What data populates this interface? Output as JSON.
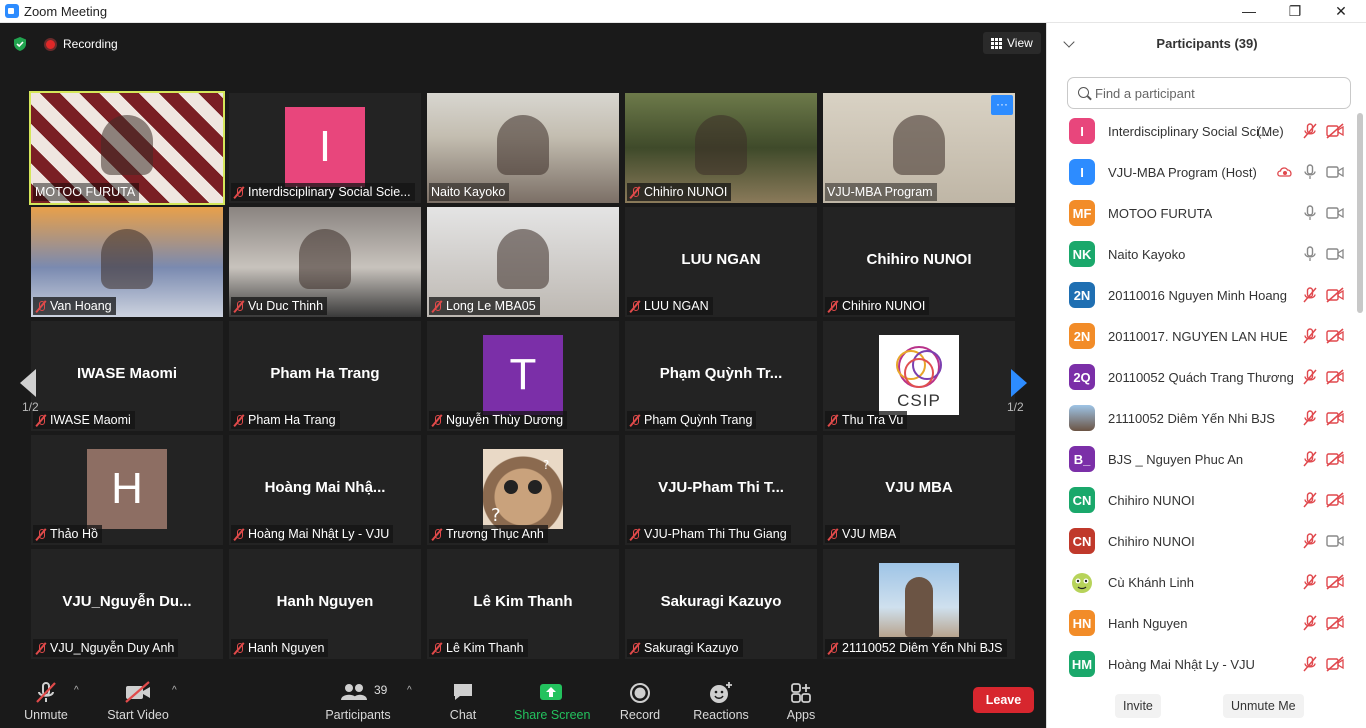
{
  "window": {
    "title": "Zoom Meeting",
    "minimize": "—",
    "restore": "❐",
    "close": "✕"
  },
  "meeting": {
    "recording_label": "Recording",
    "view_label": "View",
    "page_indicator_left": "1/2",
    "page_indicator_right": "1/2"
  },
  "tiles": [
    {
      "name": "MOTOO FURUTA",
      "muted": false,
      "kind": "video",
      "active": true
    },
    {
      "name": "Interdisciplinary Social Scie...",
      "muted": true,
      "kind": "avatar",
      "letter": "I",
      "color": "#e8467c"
    },
    {
      "name": "Naito Kayoko",
      "muted": false,
      "kind": "video"
    },
    {
      "name": "Chihiro NUNOI",
      "muted": true,
      "kind": "video"
    },
    {
      "name": "VJU-MBA Program",
      "muted": false,
      "kind": "video",
      "more": "···"
    },
    {
      "name": "Van Hoang",
      "muted": true,
      "kind": "video"
    },
    {
      "name": "Vu Duc Thinh",
      "muted": true,
      "kind": "video"
    },
    {
      "name": "Long Le MBA05",
      "muted": true,
      "kind": "video"
    },
    {
      "name": "LUU NGAN",
      "muted": true,
      "kind": "name",
      "big": "LUU NGAN"
    },
    {
      "name": "Chihiro NUNOI",
      "muted": true,
      "kind": "name",
      "big": "Chihiro NUNOI"
    },
    {
      "name": "IWASE Maomi",
      "muted": true,
      "kind": "name",
      "big": "IWASE Maomi"
    },
    {
      "name": "Pham Ha Trang",
      "muted": true,
      "kind": "name",
      "big": "Pham Ha Trang"
    },
    {
      "name": "Nguyễn Thùy Dương",
      "muted": true,
      "kind": "avatar",
      "letter": "T",
      "color": "#7b2fa8"
    },
    {
      "name": "Phạm Quỳnh Trang",
      "muted": true,
      "kind": "name",
      "big": "Phạm Quỳnh Tr..."
    },
    {
      "name": "Thu Tra Vu",
      "muted": true,
      "kind": "logo",
      "logo_text": "CSIP"
    },
    {
      "name": "Thảo Hồ",
      "muted": true,
      "kind": "avatar",
      "letter": "H",
      "color": "#8d6e63"
    },
    {
      "name": "Hoàng Mai Nhật Ly - VJU",
      "muted": true,
      "kind": "name",
      "big": "Hoàng  Mai  Nhậ..."
    },
    {
      "name": "Trương Thục Anh",
      "muted": true,
      "kind": "cat"
    },
    {
      "name": "VJU-Pham Thi Thu Giang",
      "muted": true,
      "kind": "name",
      "big": "VJU-Pham  Thi  T..."
    },
    {
      "name": "VJU MBA",
      "muted": true,
      "kind": "name",
      "big": "VJU MBA"
    },
    {
      "name": "VJU_Nguyễn Duy Anh",
      "muted": true,
      "kind": "name",
      "big": "VJU_Nguyễn  Du..."
    },
    {
      "name": "Hanh Nguyen",
      "muted": true,
      "kind": "name",
      "big": "Hanh Nguyen"
    },
    {
      "name": "Lê Kim Thanh",
      "muted": true,
      "kind": "name",
      "big": "Lê Kim Thanh"
    },
    {
      "name": "Sakuragi Kazuyo",
      "muted": true,
      "kind": "name",
      "big": "Sakuragi Kazuyo"
    },
    {
      "name": "21110052 Diêm Yến Nhi BJS",
      "muted": true,
      "kind": "portrait"
    }
  ],
  "toolbar": {
    "unmute": "Unmute",
    "start_video": "Start Video",
    "participants": "Participants",
    "participants_count": "39",
    "chat": "Chat",
    "share_screen": "Share Screen",
    "record": "Record",
    "reactions": "Reactions",
    "apps": "Apps",
    "leave": "Leave"
  },
  "panel": {
    "title": "Participants (39)",
    "search_placeholder": "Find a participant",
    "invite": "Invite",
    "unmute_me": "Unmute Me",
    "participants": [
      {
        "initials": "I",
        "color": "#e8467c",
        "name": "Interdisciplinary Social Sci...",
        "tag": "(Me)",
        "mic": "off",
        "cam": "off"
      },
      {
        "initials": "I",
        "color": "#2d8cff",
        "name": "VJU-MBA Program (Host)",
        "mic": "on",
        "cam": "on",
        "rec": true
      },
      {
        "initials": "MF",
        "color": "#f28c28",
        "name": "MOTOO FURUTA",
        "mic": "on",
        "cam": "on"
      },
      {
        "initials": "NK",
        "color": "#1aa86b",
        "name": "Naito Kayoko",
        "mic": "on",
        "cam": "on"
      },
      {
        "initials": "2N",
        "color": "#1f6fb2",
        "name": "20110016 Nguyen Minh Hoang",
        "mic": "off",
        "cam": "off"
      },
      {
        "initials": "2N",
        "color": "#f28c28",
        "name": "20110017. NGUYEN LAN HUE",
        "mic": "off",
        "cam": "off"
      },
      {
        "initials": "2Q",
        "color": "#7b2fa8",
        "name": "20110052 Quách Trang Thương",
        "mic": "off",
        "cam": "off"
      },
      {
        "initials": "",
        "color": "#6d5a54",
        "name": "21110052 Diêm Yến Nhi BJS",
        "mic": "off",
        "cam": "off",
        "photo": true
      },
      {
        "initials": "B_",
        "color": "#7b2fa8",
        "name": "BJS _ Nguyen Phuc An",
        "mic": "off",
        "cam": "off"
      },
      {
        "initials": "CN",
        "color": "#1aa86b",
        "name": "Chihiro NUNOI",
        "mic": "off",
        "cam": "off"
      },
      {
        "initials": "CN",
        "color": "#c0392b",
        "name": "Chihiro NUNOI",
        "mic": "off",
        "cam": "on"
      },
      {
        "initials": "",
        "color": "#ffffff",
        "name": "Cù Khánh Linh",
        "mic": "off",
        "cam": "off",
        "cartoon": true
      },
      {
        "initials": "HN",
        "color": "#f28c28",
        "name": "Hanh Nguyen",
        "mic": "off",
        "cam": "off"
      },
      {
        "initials": "HM",
        "color": "#1aa86b",
        "name": "Hoàng Mai Nhật Ly - VJU",
        "mic": "off",
        "cam": "off"
      }
    ]
  }
}
